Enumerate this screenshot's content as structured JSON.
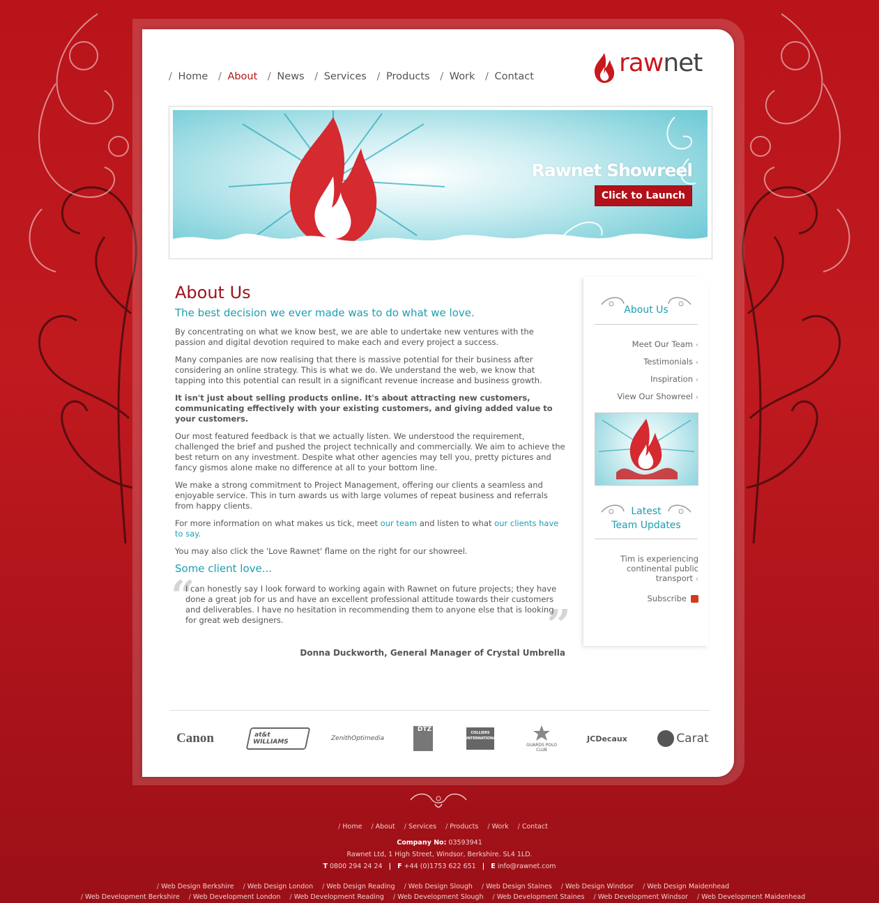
{
  "nav": {
    "items": [
      {
        "label": "Home",
        "active": false
      },
      {
        "label": "About",
        "active": true
      },
      {
        "label": "News",
        "active": false
      },
      {
        "label": "Services",
        "active": false
      },
      {
        "label": "Products",
        "active": false
      },
      {
        "label": "Work",
        "active": false
      },
      {
        "label": "Contact",
        "active": false
      }
    ],
    "separator": "/"
  },
  "logo": {
    "raw": "raw",
    "net": "net",
    "icon": "flame-icon"
  },
  "banner": {
    "title": "Rawnet Showreel",
    "button": "Click to Launch"
  },
  "main": {
    "heading": "About Us",
    "subheading": "The best decision we ever made was to do what we love.",
    "p1": "By concentrating on what we know best, we are able to undertake new ventures with the passion and digital devotion required to make each and every project a success.",
    "p2": "Many companies are now realising that there is massive potential for their business after considering an online strategy. This is what we do. We understand the web, we know that tapping into this potential can result in a significant revenue increase and business growth.",
    "p3": "It isn't just about selling products online. It's about attracting new customers, communicating effectively with your existing customers, and giving added value to your customers.",
    "p4": "Our most featured feedback is that we actually listen. We understood the requirement, challenged the brief and pushed the project technically and commercially. We aim to achieve the best return on any investment. Despite what other agencies may tell you, pretty pictures and fancy gismos alone make no difference at all to your bottom line.",
    "p5": "We make a strong commitment to Project Management, offering our clients a seamless and enjoyable service. This in turn awards us with large volumes of repeat business and referrals from happy clients.",
    "p6_pre": "For more information on what makes us tick, meet ",
    "p6_link1": "our team",
    "p6_mid": " and listen to what ",
    "p6_link2": "our clients have to say",
    "p6_post": ".",
    "p7": "You may also click the 'Love Rawnet' flame on the right for our showreel.",
    "client_heading": "Some client love...",
    "quote": "I can honestly say I look forward to working again with Rawnet on future projects; they have done a great job for us and have an excellent professional attitude towards their customers and deliverables. I have no hesitation in recommending them to anyone else that is looking for great web designers.",
    "author": "Donna Duckworth, General Manager of Crystal Umbrella"
  },
  "sidebar": {
    "heading": "About Us",
    "links": [
      "Meet Our Team",
      "Testimonials",
      "Inspiration",
      "View Our Showreel"
    ],
    "updates_heading_1": "Latest",
    "updates_heading_2": "Team Updates",
    "update_text": "Tim is experiencing continental public transport",
    "subscribe": "Subscribe",
    "chevron": "‹"
  },
  "clients": [
    "Canon",
    "at&t WILLIAMS",
    "ZenithOptimedia",
    "DTZ",
    "COLLIERS INTERNATIONAL",
    "GUARDS POLO CLUB",
    "JCDecaux",
    "Carat"
  ],
  "footer": {
    "nav": [
      "Home",
      "About",
      "Services",
      "Products",
      "Work",
      "Contact"
    ],
    "company_label": "Company No:",
    "company_no": "03593941",
    "address": "Rawnet Ltd, 1 High Street, Windsor, Berkshire. SL4 1LD.",
    "t_label": "T",
    "phone": "0800 294 24 24",
    "f_label": "F",
    "fax": "+44 (0)1753 622 651",
    "e_label": "E",
    "email": "info@rawnet.com",
    "design_links": [
      "Web Design Berkshire",
      "Web Design London",
      "Web Design Reading",
      "Web Design Slough",
      "Web Design Staines",
      "Web Design Windsor",
      "Web Design Maidenhead"
    ],
    "dev_links": [
      "Web Development Berkshire",
      "Web Development London",
      "Web Development Reading",
      "Web Development Slough",
      "Web Development Staines",
      "Web Development Windsor",
      "Web Development Maidenhead"
    ]
  }
}
